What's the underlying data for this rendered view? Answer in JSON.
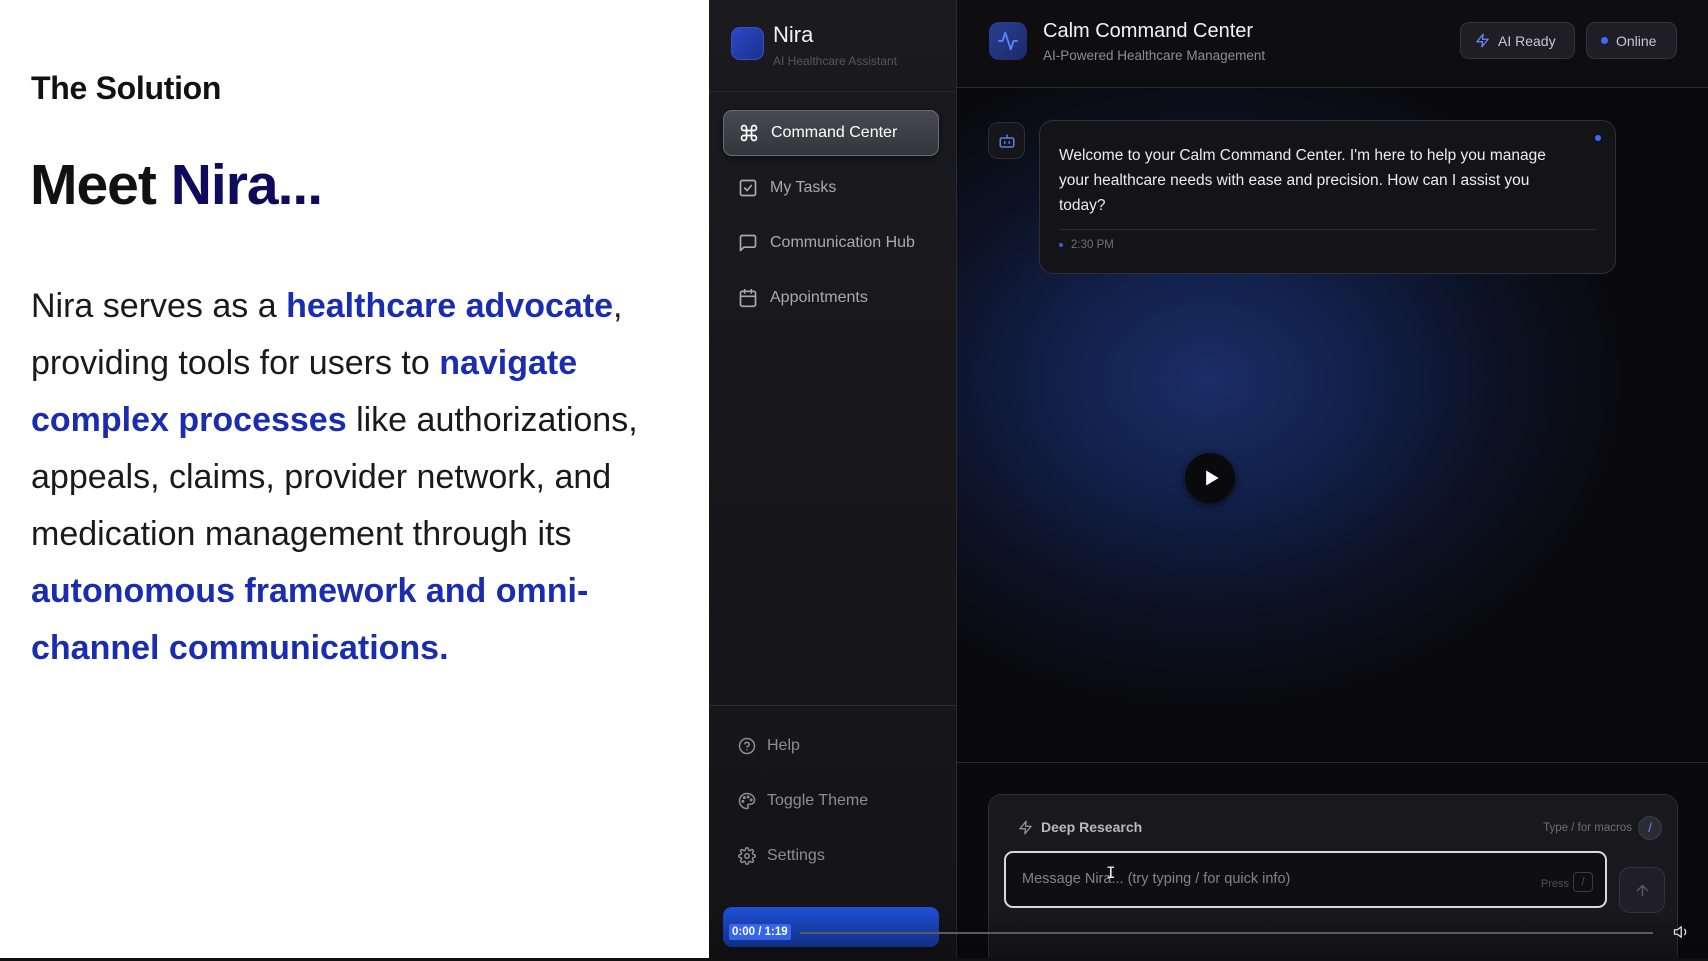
{
  "slide": {
    "section_title": "The Solution",
    "headline_prefix": "Meet ",
    "headline_brand": "Nira...",
    "body": {
      "t1": "Nira serves as a ",
      "h1": "healthcare advocate",
      "t2": ", providing tools for users to ",
      "h2": "navigate complex processes",
      "t3": " like authorizations, appeals, claims, provider network, and medication management through its ",
      "h3": "autonomous framework and omni-channel communications."
    }
  },
  "app": {
    "name": "Nira",
    "subtitle": "AI Healthcare Assistant",
    "accent": "#3b6bff",
    "nav": [
      {
        "label": "Command Center",
        "icon": "command-icon",
        "active": true
      },
      {
        "label": "My Tasks",
        "icon": "checkbox-icon"
      },
      {
        "label": "Communication Hub",
        "icon": "message-icon"
      },
      {
        "label": "Appointments",
        "icon": "calendar-icon"
      }
    ],
    "footer": [
      {
        "label": "Help",
        "icon": "help-icon"
      },
      {
        "label": "Toggle Theme",
        "icon": "palette-icon"
      },
      {
        "label": "Settings",
        "icon": "gear-icon"
      }
    ],
    "header": {
      "title": "Calm Command Center",
      "subtitle": "AI-Powered Healthcare Management",
      "badge_ai": "AI Ready",
      "badge_status": "Online"
    },
    "message": {
      "text": "Welcome to your Calm Command Center. I'm here to help you manage your healthcare needs with ease and precision. How can I assist you today?",
      "time": "2:30 PM"
    },
    "composer": {
      "mode": "Deep Research",
      "macro_hint": "Type / for macros",
      "macro_key": "/",
      "placeholder": "Message Nira... (try typing / for quick info)",
      "press_label": "Press",
      "press_key": "/"
    }
  },
  "video": {
    "time": "0:00 / 1:19"
  }
}
